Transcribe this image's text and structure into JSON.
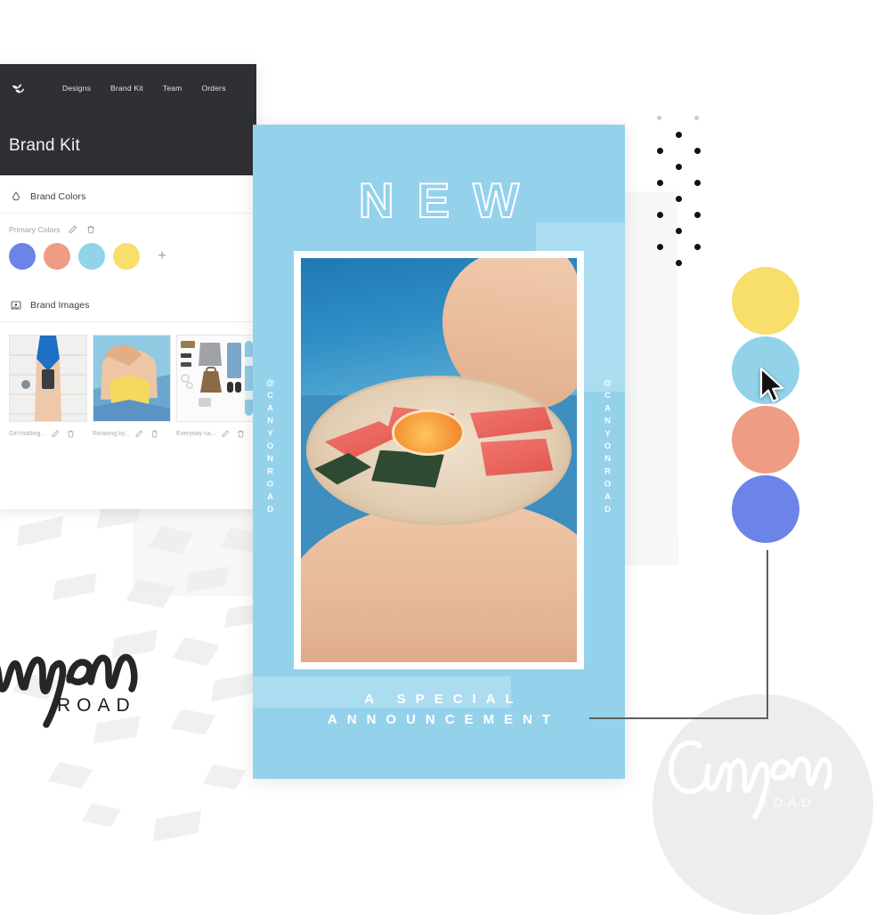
{
  "app": {
    "logo_icon": "brand-leaf-logo",
    "nav": [
      {
        "label": "Designs"
      },
      {
        "label": "Brand Kit"
      },
      {
        "label": "Team"
      },
      {
        "label": "Orders"
      }
    ],
    "title": "Brand Kit",
    "header_bg": "#2e3035",
    "brand_colors": {
      "icon": "droplet-icon",
      "section_label": "Brand Colors",
      "group_label": "Primary Colors",
      "edit_icon": "pencil-icon",
      "delete_icon": "trash-icon",
      "add_label": "+",
      "swatches": [
        {
          "name": "periwinkle",
          "hex": "#6c84e8"
        },
        {
          "name": "salmon",
          "hex": "#ee9c83"
        },
        {
          "name": "sky",
          "hex": "#92d3ea"
        },
        {
          "name": "yellow",
          "hex": "#f8de6a"
        }
      ]
    },
    "brand_images": {
      "icon": "image-icon",
      "section_label": "Brand Images",
      "edit_icon": "pencil-icon",
      "delete_icon": "trash-icon",
      "items": [
        {
          "caption": "Girl holding..."
        },
        {
          "caption": "Relaxing by..."
        },
        {
          "caption": "Everyday ca..."
        }
      ]
    }
  },
  "poster": {
    "background": "#94d2ec",
    "headline": "NEW",
    "handle_left": "@CANYONROAD",
    "handle_right": "@CANYONROAD",
    "footer_line1": "A SPECIAL",
    "footer_line2": "ANNOUNCEMENT",
    "photo_alt": "woman by pool holding wooden tray of watermelon slices and orange"
  },
  "swatch_stack": [
    {
      "name": "yellow",
      "hex": "#f8de6a"
    },
    {
      "name": "sky",
      "hex": "#92d3ea"
    },
    {
      "name": "salmon",
      "hex": "#ee9c83"
    },
    {
      "name": "periwinkle",
      "hex": "#6c84e8"
    }
  ],
  "cursor": {
    "icon": "mouse-pointer-icon"
  },
  "logos": {
    "primary": {
      "script": "Canyon",
      "wordmark": "ROAD"
    },
    "watermark": {
      "script": "Canyon",
      "wordmark": "ROAD"
    }
  },
  "decor": {
    "dot_grid_icon": "dot-grid-pattern",
    "confetti_icon": "confetti-pattern",
    "connector_icon": "connector-line"
  }
}
